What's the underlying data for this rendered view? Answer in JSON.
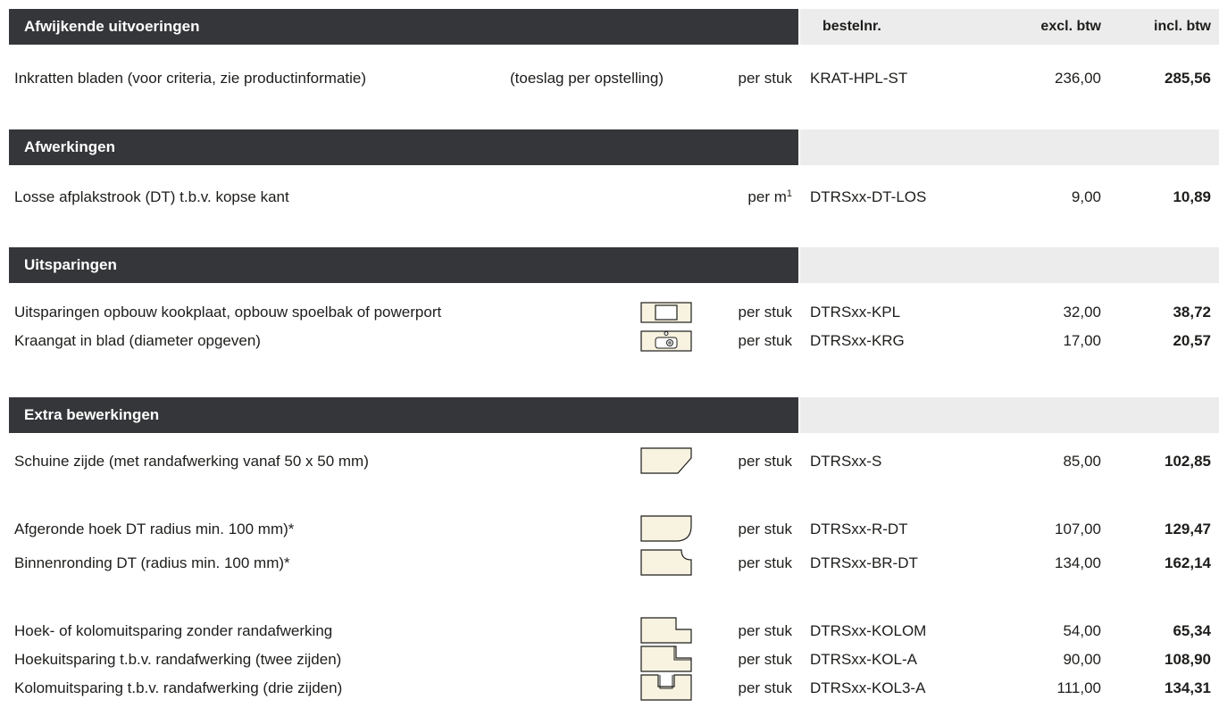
{
  "colors": {
    "header_dark": "#353639",
    "header_light": "#ececec",
    "icon_fill": "#f8f3e0",
    "icon_stroke": "#1d1d1b"
  },
  "columns": {
    "code": "bestelnr.",
    "excl": "excl. btw",
    "incl": "incl. btw"
  },
  "sections": [
    {
      "title": "Afwijkende uitvoeringen",
      "rows": [
        {
          "desc": "Inkratten bladen (voor criteria, zie productinformatie)",
          "note": "(toeslag per opstelling)",
          "unit": "per stuk",
          "code": "KRAT-HPL-ST",
          "excl": "236,00",
          "incl": "285,56"
        }
      ]
    },
    {
      "title": "Afwerkingen",
      "rows": [
        {
          "desc": "Losse afplakstrook (DT) t.b.v. kopse kant",
          "unit": "per m",
          "unit_sup": "1",
          "code": "DTRSxx-DT-LOS",
          "excl": "9,00",
          "incl": "10,89"
        }
      ]
    },
    {
      "title": "Uitsparingen",
      "rows": [
        {
          "desc": "Uitsparingen opbouw kookplaat, opbouw spoelbak of powerport",
          "icon": "cutout-square-icon",
          "unit": "per stuk",
          "code": "DTRSxx-KPL",
          "excl": "32,00",
          "incl": "38,72"
        },
        {
          "desc": "Kraangat in blad (diameter opgeven)",
          "icon": "tap-hole-sink-icon",
          "unit": "per stuk",
          "code": "DTRSxx-KRG",
          "excl": "17,00",
          "incl": "20,57"
        }
      ]
    },
    {
      "title": "Extra bewerkingen",
      "rows": [
        {
          "desc": "Schuine zijde (met randafwerking vanaf 50 x 50 mm)",
          "icon": "bevel-corner-icon",
          "unit": "per stuk",
          "code": "DTRSxx-S",
          "excl": "85,00",
          "incl": "102,85"
        },
        {
          "desc": "Afgeronde hoek DT radius min. 100 mm)*",
          "icon": "rounded-corner-icon",
          "unit": "per stuk",
          "code": "DTRSxx-R-DT",
          "excl": "107,00",
          "incl": "129,47"
        },
        {
          "desc": "Binnenronding DT (radius min. 100 mm)*",
          "icon": "inner-rounding-icon",
          "unit": "per stuk",
          "code": "DTRSxx-BR-DT",
          "excl": "134,00",
          "incl": "162,14"
        },
        {
          "desc": "Hoek- of kolomuitsparing zonder randafwerking",
          "icon": "corner-notch-icon",
          "unit": "per stuk",
          "code": "DTRSxx-KOLOM",
          "excl": "54,00",
          "incl": "65,34"
        },
        {
          "desc": "Hoekuitsparing t.b.v. randafwerking (twee zijden)",
          "icon": "corner-notch-edged-icon",
          "unit": "per stuk",
          "code": "DTRSxx-KOL-A",
          "excl": "90,00",
          "incl": "108,90"
        },
        {
          "desc": "Kolomuitsparing t.b.v. randafwerking (drie zijden)",
          "icon": "column-notch-icon",
          "unit": "per stuk",
          "code": "DTRSxx-KOL3-A",
          "excl": "111,00",
          "incl": "134,31"
        }
      ]
    }
  ]
}
